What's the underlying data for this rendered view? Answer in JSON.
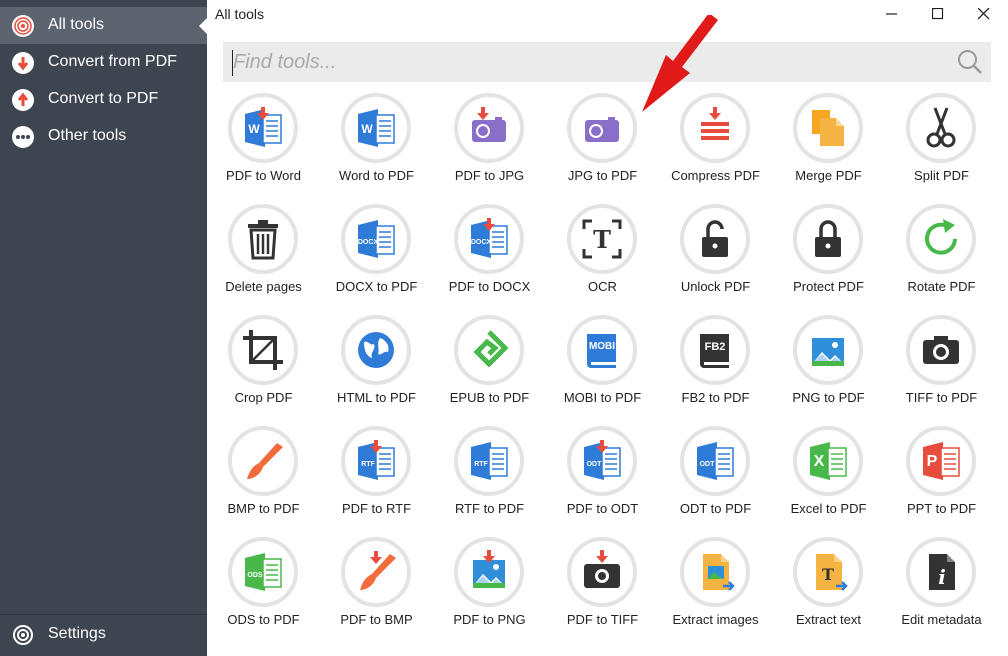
{
  "sidebar": {
    "items": [
      {
        "label": "All tools",
        "icon": "all-tools-icon"
      },
      {
        "label": "Convert from PDF",
        "icon": "convert-from-icon"
      },
      {
        "label": "Convert to PDF",
        "icon": "convert-to-icon"
      },
      {
        "label": "Other tools",
        "icon": "more-dots-icon"
      }
    ],
    "settings": {
      "label": "Settings",
      "icon": "gear-icon"
    }
  },
  "window": {
    "title": "All tools"
  },
  "search": {
    "placeholder": "Find tools..."
  },
  "colors": {
    "sidebar": "#3d4550",
    "active": "#5a636e",
    "accent_red": "#e74c3c",
    "word_blue": "#2f7bd8",
    "purple": "#8a6fc8",
    "green": "#49b84a",
    "orange": "#f5a623"
  },
  "tools": [
    {
      "label": "PDF to Word",
      "icon": "pdf-to-word-icon"
    },
    {
      "label": "Word to PDF",
      "icon": "word-to-pdf-icon"
    },
    {
      "label": "PDF to JPG",
      "icon": "pdf-to-jpg-icon"
    },
    {
      "label": "JPG to PDF",
      "icon": "jpg-to-pdf-icon"
    },
    {
      "label": "Compress PDF",
      "icon": "compress-pdf-icon"
    },
    {
      "label": "Merge PDF",
      "icon": "merge-pdf-icon"
    },
    {
      "label": "Split PDF",
      "icon": "scissors-icon"
    },
    {
      "label": "Delete pages",
      "icon": "trash-icon"
    },
    {
      "label": "DOCX to PDF",
      "icon": "docx-to-pdf-icon"
    },
    {
      "label": "PDF to DOCX",
      "icon": "pdf-to-docx-icon"
    },
    {
      "label": "OCR",
      "icon": "ocr-icon"
    },
    {
      "label": "Unlock PDF",
      "icon": "unlock-icon"
    },
    {
      "label": "Protect PDF",
      "icon": "lock-icon"
    },
    {
      "label": "Rotate PDF",
      "icon": "rotate-icon"
    },
    {
      "label": "Crop PDF",
      "icon": "crop-icon"
    },
    {
      "label": "HTML to PDF",
      "icon": "globe-icon"
    },
    {
      "label": "EPUB to PDF",
      "icon": "epub-icon"
    },
    {
      "label": "MOBI to PDF",
      "icon": "mobi-icon"
    },
    {
      "label": "FB2 to PDF",
      "icon": "fb2-icon"
    },
    {
      "label": "PNG to PDF",
      "icon": "png-to-pdf-icon"
    },
    {
      "label": "TIFF to PDF",
      "icon": "tiff-to-pdf-icon"
    },
    {
      "label": "BMP to PDF",
      "icon": "bmp-to-pdf-icon"
    },
    {
      "label": "PDF to RTF",
      "icon": "pdf-to-rtf-icon"
    },
    {
      "label": "RTF to PDF",
      "icon": "rtf-to-pdf-icon"
    },
    {
      "label": "PDF to ODT",
      "icon": "pdf-to-odt-icon"
    },
    {
      "label": "ODT to PDF",
      "icon": "odt-to-pdf-icon"
    },
    {
      "label": "Excel to PDF",
      "icon": "excel-to-pdf-icon"
    },
    {
      "label": "PPT to PDF",
      "icon": "ppt-to-pdf-icon"
    },
    {
      "label": "ODS to PDF",
      "icon": "ods-to-pdf-icon"
    },
    {
      "label": "PDF to BMP",
      "icon": "pdf-to-bmp-icon"
    },
    {
      "label": "PDF to PNG",
      "icon": "pdf-to-png-icon"
    },
    {
      "label": "PDF to TIFF",
      "icon": "pdf-to-tiff-icon"
    },
    {
      "label": "Extract images",
      "icon": "extract-images-icon"
    },
    {
      "label": "Extract text",
      "icon": "extract-text-icon"
    },
    {
      "label": "Edit metadata",
      "icon": "metadata-icon"
    }
  ],
  "icon_labels": {
    "docx": "DOCX",
    "rtf": "RTF",
    "odt": "ODT",
    "ods": "ODS",
    "mobi": "MOBI",
    "fb2": "FB2",
    "excel": "X",
    "ppt": "P",
    "text": "T",
    "info": "i",
    "w": "W"
  }
}
